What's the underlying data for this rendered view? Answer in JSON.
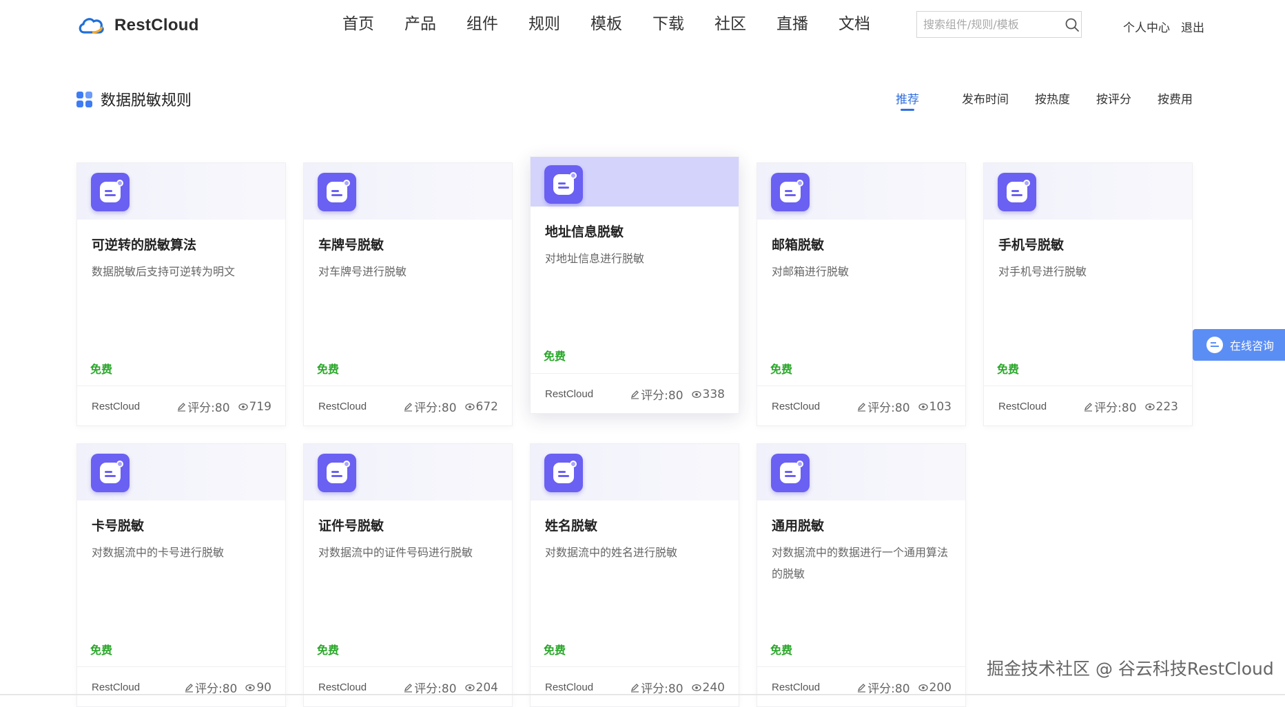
{
  "brand": {
    "name": "RestCloud",
    "color": "#3f7cf4"
  },
  "nav": {
    "items": [
      "首页",
      "产品",
      "组件",
      "规则",
      "模板",
      "下载",
      "社区",
      "直播",
      "文档"
    ]
  },
  "search": {
    "placeholder": "搜索组件/规则/模板",
    "icon": "search-icon"
  },
  "user": {
    "center": "个人中心",
    "logout": "退出"
  },
  "page": {
    "title": "数据脱敏规则",
    "sort_tabs": [
      "推荐",
      "发布时间",
      "按热度",
      "按评分",
      "按费用"
    ],
    "active_sort": "推荐"
  },
  "cards": [
    {
      "title": "可逆转的脱敏算法",
      "desc": "数据脱敏后支持可逆转为明文",
      "price": "免费",
      "author": "RestCloud",
      "score": "评分:80",
      "views": "719"
    },
    {
      "title": "车牌号脱敏",
      "desc": "对车牌号进行脱敏",
      "price": "免费",
      "author": "RestCloud",
      "score": "评分:80",
      "views": "672"
    },
    {
      "title": "地址信息脱敏",
      "desc": "对地址信息进行脱敏",
      "price": "免费",
      "author": "RestCloud",
      "score": "评分:80",
      "views": "338"
    },
    {
      "title": "邮箱脱敏",
      "desc": "对邮箱进行脱敏",
      "price": "免费",
      "author": "RestCloud",
      "score": "评分:80",
      "views": "103"
    },
    {
      "title": "手机号脱敏",
      "desc": "对手机号进行脱敏",
      "price": "免费",
      "author": "RestCloud",
      "score": "评分:80",
      "views": "223"
    },
    {
      "title": "卡号脱敏",
      "desc": "对数据流中的卡号进行脱敏",
      "price": "免费",
      "author": "RestCloud",
      "score": "评分:80",
      "views": "90"
    },
    {
      "title": "证件号脱敏",
      "desc": "对数据流中的证件号码进行脱敏",
      "price": "免费",
      "author": "RestCloud",
      "score": "评分:80",
      "views": "204"
    },
    {
      "title": "姓名脱敏",
      "desc": "对数据流中的姓名进行脱敏",
      "price": "免费",
      "author": "RestCloud",
      "score": "评分:80",
      "views": "240"
    },
    {
      "title": "通用脱敏",
      "desc": "对数据流中的数据进行一个通用算法的脱敏",
      "price": "免费",
      "author": "RestCloud",
      "score": "评分:80",
      "views": "200"
    }
  ],
  "consult": {
    "label": "在线咨询"
  },
  "watermark": "掘金技术社区 @ 谷云科技RestCloud",
  "colors": {
    "accent": "#2f6fe0",
    "card_icon": "#6a60f2",
    "free": "#2aa72a",
    "consult": "#5b8ef5"
  }
}
